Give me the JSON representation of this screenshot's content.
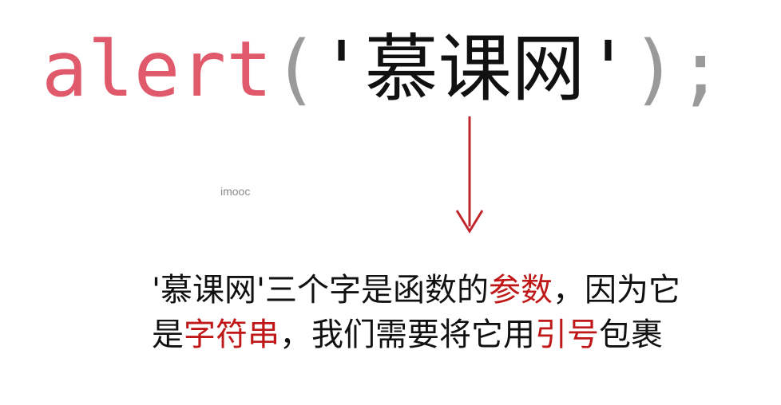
{
  "code": {
    "func": "alert",
    "open_paren": "(",
    "quote_open": "'",
    "argument": "慕课网",
    "quote_close": "'",
    "close_paren": ")",
    "semicolon": ";"
  },
  "watermark": "imooc",
  "caption": {
    "line1": [
      {
        "text": "'慕课网'三个字是函数的",
        "highlight": false
      },
      {
        "text": "参数",
        "highlight": true
      },
      {
        "text": "，因为它",
        "highlight": false
      }
    ],
    "line2": [
      {
        "text": "是",
        "highlight": false
      },
      {
        "text": "字符串",
        "highlight": true
      },
      {
        "text": "，我们需要将它用",
        "highlight": false
      },
      {
        "text": "引号",
        "highlight": true
      },
      {
        "text": "包裹",
        "highlight": false
      }
    ]
  },
  "colors": {
    "keyword": "#e05a6c",
    "punctuation": "#9a9a9a",
    "highlight": "#c01818",
    "arrow": "#c0272d"
  }
}
